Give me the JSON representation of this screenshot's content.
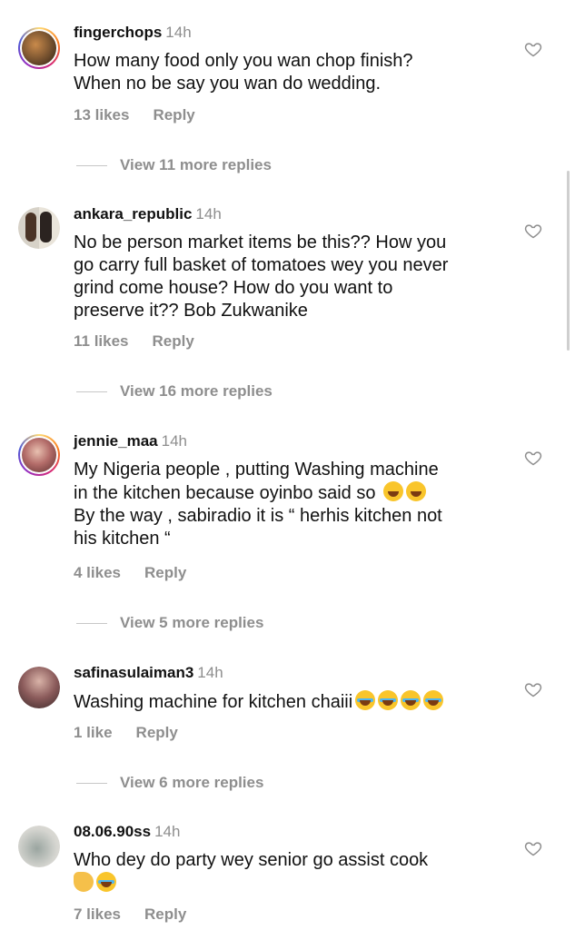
{
  "comments": [
    {
      "username": "fingerchops",
      "time": "14h",
      "lines": [
        "How many food only you wan chop finish?",
        "When no be say you wan do wedding."
      ],
      "likes": "13 likes",
      "reply": "Reply",
      "view_replies": "View 11 more replies"
    },
    {
      "username": "ankara_republic",
      "time": "14h",
      "lines": [
        "No be person market items be this?? How you",
        "go carry full basket of tomatoes wey you never",
        "grind come house? How do you want to",
        "preserve it?? Bob Zukwanike"
      ],
      "likes": "11 likes",
      "reply": "Reply",
      "view_replies": "View 16 more replies"
    },
    {
      "username": "jennie_maa",
      "time": "14h",
      "lines": [
        "My Nigeria people , putting Washing machine",
        "in the kitchen because oyinbo said so",
        " By the way , sabiradio it is “ herhis kitchen not",
        "his kitchen “"
      ],
      "likes": "4 likes",
      "reply": "Reply",
      "view_replies": "View 5 more replies"
    },
    {
      "username": "safinasulaiman3",
      "time": "14h",
      "lines": [
        "Washing machine for kitchen chaiii"
      ],
      "likes": "1 like",
      "reply": "Reply",
      "view_replies": "View 6 more replies"
    },
    {
      "username": "08.06.90ss",
      "time": "14h",
      "lines": [
        "Who dey do party wey senior go assist cook"
      ],
      "likes": "7 likes",
      "reply": "Reply"
    }
  ],
  "icons": {
    "like": "heart-outline-icon",
    "laugh": "grinning-squinting-face-emoji",
    "cry_laugh": "face-with-tears-of-joy-emoji",
    "flex": "flexed-biceps-emoji"
  },
  "colors": {
    "muted": "#8e8e8e",
    "text": "#111111"
  }
}
